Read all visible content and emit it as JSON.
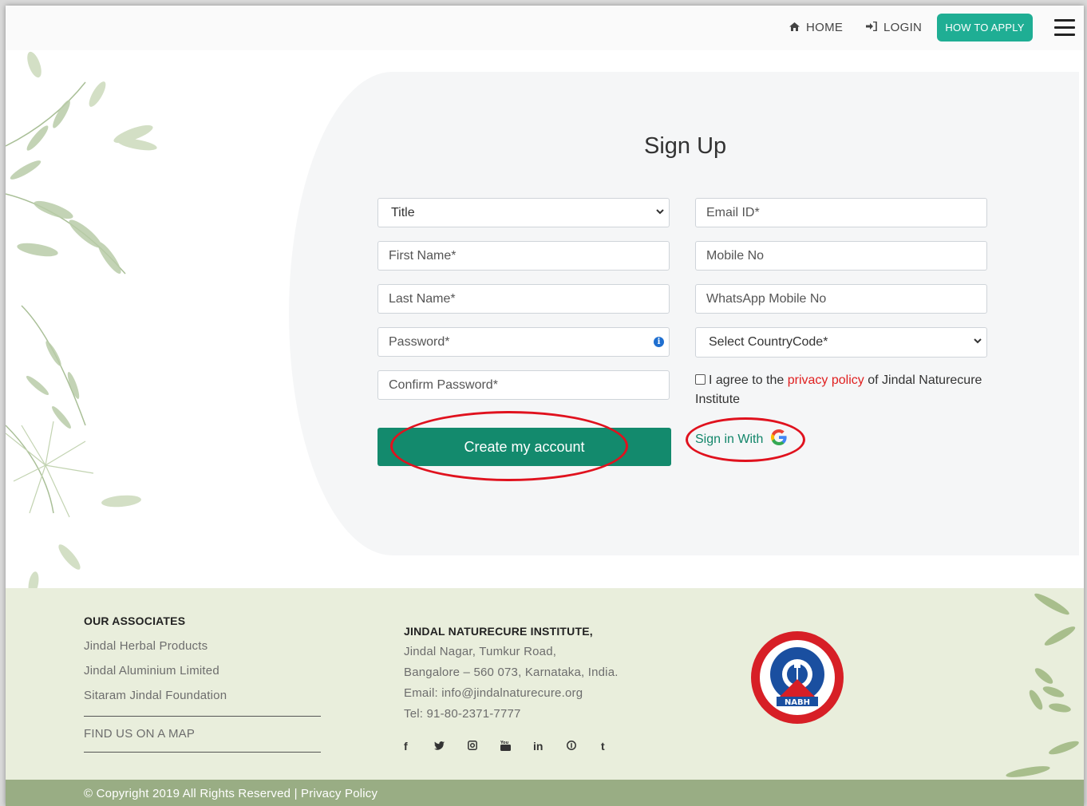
{
  "nav": {
    "home": "HOME",
    "login": "LOGIN",
    "apply": "HOW TO APPLY"
  },
  "form": {
    "heading": "Sign Up",
    "title_select": "Title",
    "first_name_placeholder": "First Name*",
    "last_name_placeholder": "Last Name*",
    "password_placeholder": "Password*",
    "confirm_password_placeholder": "Confirm Password*",
    "email_placeholder": "Email ID*",
    "mobile_placeholder": "Mobile No",
    "whatsapp_placeholder": "WhatsApp Mobile No",
    "country_select": "Select CountryCode*",
    "agree_prefix": "I agree to the",
    "agree_link": "privacy policy",
    "agree_suffix": "of Jindal Naturecure Institute",
    "create_button": "Create my account",
    "google_signin": "Sign in With"
  },
  "footer": {
    "associates_heading": "OUR ASSOCIATES",
    "associates": [
      "Jindal Herbal Products",
      "Jindal Aluminium Limited",
      "Sitaram Jindal Foundation"
    ],
    "map_link": "FIND US ON A MAP",
    "institute_heading": "JINDAL NATURECURE INSTITUTE,",
    "address_line1": "Jindal Nagar, Tumkur Road,",
    "address_line2": "Bangalore – 560 073, Karnataka, India.",
    "email": "Email: info@jindalnaturecure.org",
    "tel": "Tel:  91-80-2371-7777",
    "social_icons": [
      "facebook-icon",
      "twitter-icon",
      "instagram-icon",
      "youtube-icon",
      "linkedin-icon",
      "pinterest-icon",
      "tumblr-icon"
    ],
    "badge_text": "NABH",
    "copyright": "© Copyright 2019 All Rights Reserved | Privacy Policy"
  },
  "colors": {
    "accent": "#1fae94",
    "primary_button": "#138a6d",
    "link_red": "#e02020",
    "annotation": "#e0121e",
    "footer_bg": "#e9eedc",
    "copyright_bg": "#99ad84"
  }
}
